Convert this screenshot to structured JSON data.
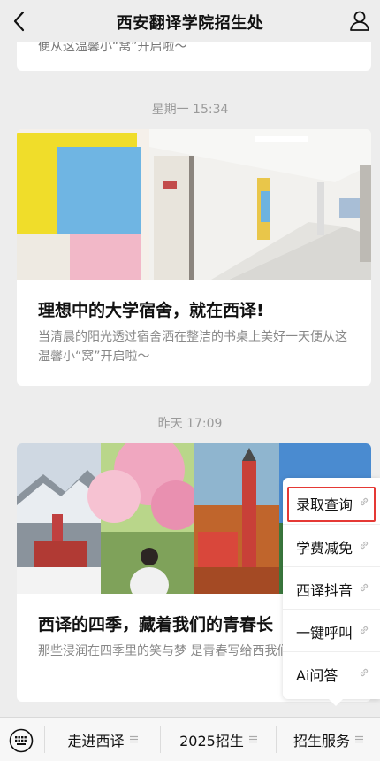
{
  "header": {
    "title": "西安翻译学院招生处"
  },
  "feed": {
    "partial_card": {
      "text": "便从这温馨小“窝”开启啦～"
    },
    "items": [
      {
        "timestamp": "星期一 15:34",
        "title": "理想中的大学宿舍，就在西译!",
        "summary": "当清晨的阳光透过宿舍洒在整洁的书桌上美好一天便从这温馨小“窝”开启啦～"
      },
      {
        "timestamp": "昨天 17:09",
        "title": "西译的四季，藏着我们的青春长",
        "summary": "那些浸润在四季里的笑与梦 是青春写给西我们的长诗!"
      }
    ]
  },
  "popup_menu": {
    "items": [
      {
        "label": "录取查询",
        "highlighted": true
      },
      {
        "label": "学费减免"
      },
      {
        "label": "西译抖音"
      },
      {
        "label": "一键呼叫"
      },
      {
        "label": "Ai问答"
      }
    ],
    "highlight_color": "#e53935"
  },
  "bottom_menu": {
    "tabs": [
      {
        "label": "走进西译"
      },
      {
        "label": "2025招生"
      },
      {
        "label": "招生服务"
      }
    ]
  },
  "icons": {
    "back": "chevron-left-icon",
    "user": "user-icon",
    "keyboard": "keyboard-icon",
    "link": "link-icon",
    "menu": "menu-lines-icon"
  }
}
